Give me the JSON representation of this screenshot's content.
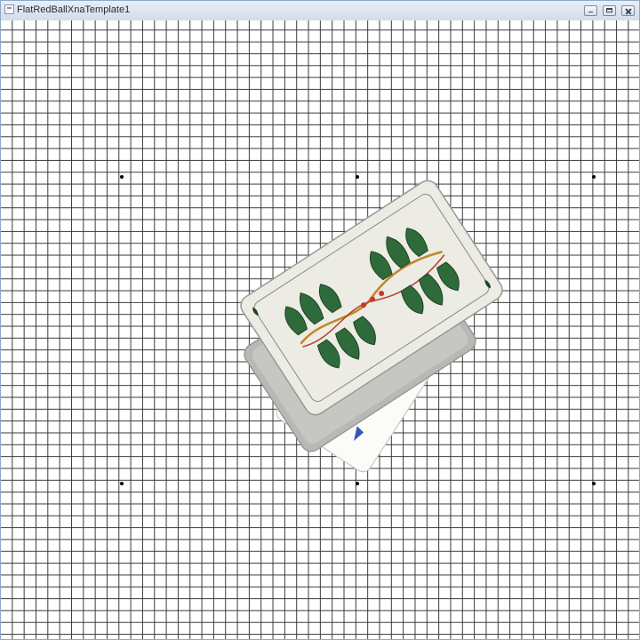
{
  "window": {
    "title": "FlatRedBallXnaTemplate1",
    "controls": [
      "minimize-icon",
      "maximize-icon",
      "close-icon"
    ]
  },
  "scene": {
    "background": "grid",
    "grid_line_color": "#3a3a3a",
    "marker_dot_color": "#000000",
    "cards": [
      {
        "name": "bottom-card",
        "face": "white playing card with red pips"
      },
      {
        "name": "middle-card",
        "face": "grey card back"
      },
      {
        "name": "top-card",
        "face": "card with green leaf suit pattern"
      }
    ]
  }
}
